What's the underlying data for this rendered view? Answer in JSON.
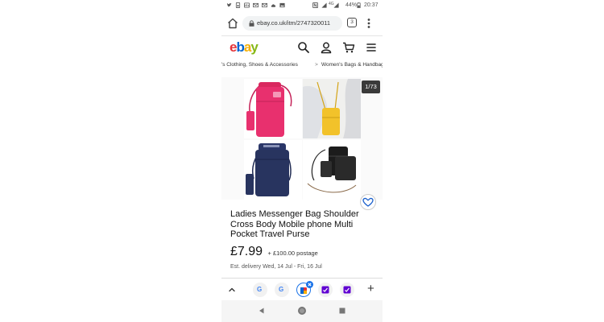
{
  "status_bar": {
    "battery": "44%",
    "time": "20:37",
    "network": "4G"
  },
  "browser": {
    "url": "ebay.co.uk/itm/2747320011",
    "tab_count": "3"
  },
  "ebay": {
    "logo": {
      "e": "e",
      "b": "b",
      "a": "a",
      "y": "y"
    },
    "icons": [
      "search-icon",
      "account-icon",
      "cart-icon",
      "hamburger-menu-icon"
    ]
  },
  "breadcrumb": {
    "item_1": "'s Clothing, Shoes & Accessories",
    "separator": ">",
    "item_2": "Women's Bags & Handbags"
  },
  "gallery": {
    "counter": "1/73",
    "bag_colors": [
      "#e8306e",
      "#f2c22a",
      "#28345f",
      "#1c1c1c"
    ]
  },
  "listing": {
    "title": "Ladies Messenger Bag Shoulder Cross Body Mobile phone Multi Pocket Travel Purse",
    "price": "£7.99",
    "postage": "+ £100.00 postage",
    "delivery": "Est. delivery Wed, 14 Jul - Fri, 16 Jul"
  },
  "tab_strip": {
    "tab_g_1": "G",
    "tab_g_2": "G",
    "add_tab": "+"
  },
  "colors": {
    "ebay_red": "#e53238",
    "ebay_blue": "#0064d2",
    "ebay_yellow": "#f5af02",
    "ebay_green": "#86b817",
    "yahoo_purple": "#6001d2",
    "active_tab_ring": "#1a73e8"
  }
}
